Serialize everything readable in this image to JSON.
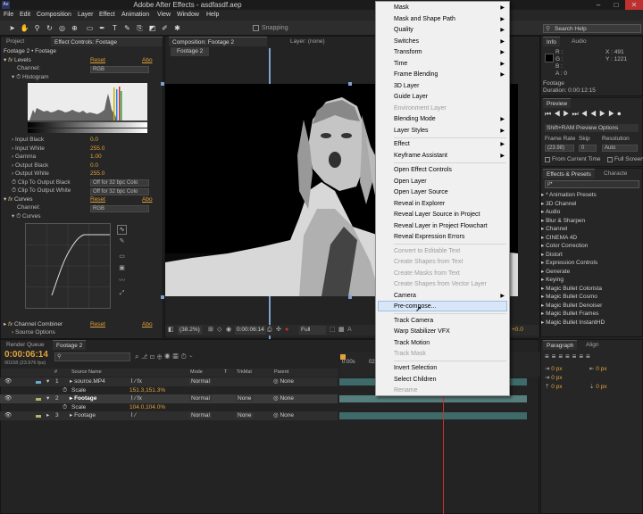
{
  "window": {
    "title": "Adobe After Effects - asdfasdf.aep",
    "app_icon": "Ae"
  },
  "menubar": [
    "File",
    "Edit",
    "Composition",
    "Layer",
    "Effect",
    "Animation",
    "View",
    "Window",
    "Help"
  ],
  "toolbar": {
    "snapping": "Snapping",
    "search_help": "Search Help"
  },
  "left_panel": {
    "tabs": [
      "Project",
      "Effect Controls: Footage"
    ],
    "header": "Footage 2 • Footage",
    "levels": {
      "label": "Levels",
      "reset": "Reset",
      "about": "Abo",
      "channel_label": "Channel:",
      "channel_value": "RGB",
      "histogram_label": "Histogram"
    },
    "params": [
      {
        "name": "Input Black",
        "value": "0.0"
      },
      {
        "name": "Input White",
        "value": "255.0"
      },
      {
        "name": "Gamma",
        "value": "1.00"
      },
      {
        "name": "Output Black",
        "value": "0.0"
      },
      {
        "name": "Output White",
        "value": "255.0"
      }
    ],
    "clip_black": {
      "name": "Clip To Output Black",
      "value": "Off for 32 bpc Colo"
    },
    "clip_white": {
      "name": "Clip To Output White",
      "value": "Off for 32 bpc Colo"
    },
    "curves": {
      "label": "Curves",
      "reset": "Reset",
      "about": "Abo",
      "channel_label": "Channel:",
      "channel_value": "RGB",
      "sub_label": "Curves"
    },
    "channel_combiner": {
      "label": "Channel Combiner",
      "reset": "Reset",
      "about": "Abo",
      "source": "Source Options"
    }
  },
  "composition": {
    "tab": "Composition: Footage 2",
    "layer_tab": "Layer: (none)",
    "subtab": "Footage 2",
    "zoom": "(38.2%)",
    "timecode": "0:00:06:14",
    "resolution": "Full",
    "exposure": "+0.0"
  },
  "context_menu": {
    "items": [
      {
        "label": "Mask",
        "sub": true,
        "disabled": false
      },
      {
        "label": "Mask and Shape Path",
        "sub": true,
        "disabled": false
      },
      {
        "label": "Quality",
        "sub": true,
        "disabled": false
      },
      {
        "label": "Switches",
        "sub": true,
        "disabled": false
      },
      {
        "label": "Transform",
        "sub": true,
        "disabled": false
      },
      {
        "label": "Time",
        "sub": true,
        "disabled": false
      },
      {
        "label": "Frame Blending",
        "sub": true,
        "disabled": false
      },
      {
        "label": "3D Layer",
        "sub": false,
        "disabled": false
      },
      {
        "label": "Guide Layer",
        "sub": false,
        "disabled": false
      },
      {
        "label": "Environment Layer",
        "sub": false,
        "disabled": true
      },
      {
        "label": "Blending Mode",
        "sub": true,
        "disabled": false
      },
      {
        "label": "Layer Styles",
        "sub": true,
        "disabled": false
      },
      {
        "sep": true
      },
      {
        "label": "Effect",
        "sub": true,
        "disabled": false
      },
      {
        "label": "Keyframe Assistant",
        "sub": true,
        "disabled": false
      },
      {
        "sep": true
      },
      {
        "label": "Open Effect Controls",
        "sub": false,
        "disabled": false
      },
      {
        "label": "Open Layer",
        "sub": false,
        "disabled": false
      },
      {
        "label": "Open Layer Source",
        "sub": false,
        "disabled": false
      },
      {
        "label": "Reveal in Explorer",
        "sub": false,
        "disabled": false
      },
      {
        "label": "Reveal Layer Source in Project",
        "sub": false,
        "disabled": false
      },
      {
        "label": "Reveal Layer in Project Flowchart",
        "sub": false,
        "disabled": false
      },
      {
        "label": "Reveal Expression Errors",
        "sub": false,
        "disabled": false
      },
      {
        "sep": true
      },
      {
        "label": "Convert to Editable Text",
        "sub": false,
        "disabled": true
      },
      {
        "label": "Create Shapes from Text",
        "sub": false,
        "disabled": true
      },
      {
        "label": "Create Masks from Text",
        "sub": false,
        "disabled": true
      },
      {
        "label": "Create Shapes from Vector Layer",
        "sub": false,
        "disabled": true
      },
      {
        "label": "Camera",
        "sub": true,
        "disabled": false
      },
      {
        "label": "Pre-compose...",
        "sub": false,
        "disabled": false,
        "highlighted": true
      },
      {
        "sep": true
      },
      {
        "label": "Track Camera",
        "sub": false,
        "disabled": false
      },
      {
        "label": "Warp Stabilizer VFX",
        "sub": false,
        "disabled": false
      },
      {
        "label": "Track Motion",
        "sub": false,
        "disabled": false
      },
      {
        "label": "Track Mask",
        "sub": false,
        "disabled": true
      },
      {
        "sep": true
      },
      {
        "label": "Invert Selection",
        "sub": false,
        "disabled": false
      },
      {
        "label": "Select Children",
        "sub": false,
        "disabled": false
      },
      {
        "label": "Rename",
        "sub": false,
        "disabled": true
      }
    ]
  },
  "info_panel": {
    "tabs": [
      "Info",
      "Audio"
    ],
    "channels": [
      "R :",
      "G :",
      "B :",
      "A : 0"
    ],
    "x": "X : 491",
    "y": "Y : 1221",
    "footage": "Footage",
    "duration": "Duration: 0:00:12:15"
  },
  "preview_panel": {
    "tab": "Preview",
    "options": "Shift+RAM Preview Options",
    "frame_rate_label": "Frame Rate",
    "skip_label": "Skip",
    "resolution_label": "Resolution",
    "frame_rate": "(23.98)",
    "skip": "0",
    "resolution": "Auto",
    "from_current": "From Current Time",
    "full_screen": "Full Screen"
  },
  "effects_panel": {
    "tabs": [
      "Effects & Presets",
      "Characte"
    ],
    "search_placeholder": "ρ•",
    "items": [
      "* Animation Presets",
      "3D Channel",
      "Audio",
      "Blur & Sharpen",
      "Channel",
      "CINEMA 4D",
      "Color Correction",
      "Distort",
      "Expression Controls",
      "Generate",
      "Keying",
      "Magic Bullet Colorista",
      "Magic Bullet Cosmo",
      "Magic Bullet Denoiser",
      "Magic Bullet Frames",
      "Magic Bullet InstantHD"
    ]
  },
  "paragraph_panel": {
    "tabs": [
      "Paragraph",
      "Align"
    ],
    "values": [
      "0 px",
      "0 px",
      "0 px",
      "0 px",
      "0 px"
    ]
  },
  "timeline": {
    "tabs": [
      "Render Queue",
      "Footage 2"
    ],
    "timecode": "0:00:06:14",
    "frame_info": "00158 (23.976 fps)",
    "columns": [
      "#",
      "Source Name",
      "Mode",
      "T",
      "TrkMat",
      "Parent"
    ],
    "ruler": [
      "0:00s",
      "02s"
    ],
    "layers": [
      {
        "num": "1",
        "name": "source.MP4",
        "mode": "Normal",
        "trkmat": "",
        "parent": "None",
        "scale_label": "Scale",
        "scale": "151.3,151.3%"
      },
      {
        "num": "2",
        "name": "Footage",
        "mode": "Normal",
        "trkmat": "None",
        "parent": "None",
        "scale_label": "Scale",
        "scale": "104.0,104.0%"
      },
      {
        "num": "3",
        "name": "Footage",
        "mode": "Normal",
        "trkmat": "None",
        "parent": "None"
      }
    ]
  },
  "colors": {
    "accent_orange": "#e0a23a",
    "timeline_bar": "#3e6b6a",
    "menu_bg": "#f0f0f0",
    "menu_highlight": "#d9e6f7"
  }
}
